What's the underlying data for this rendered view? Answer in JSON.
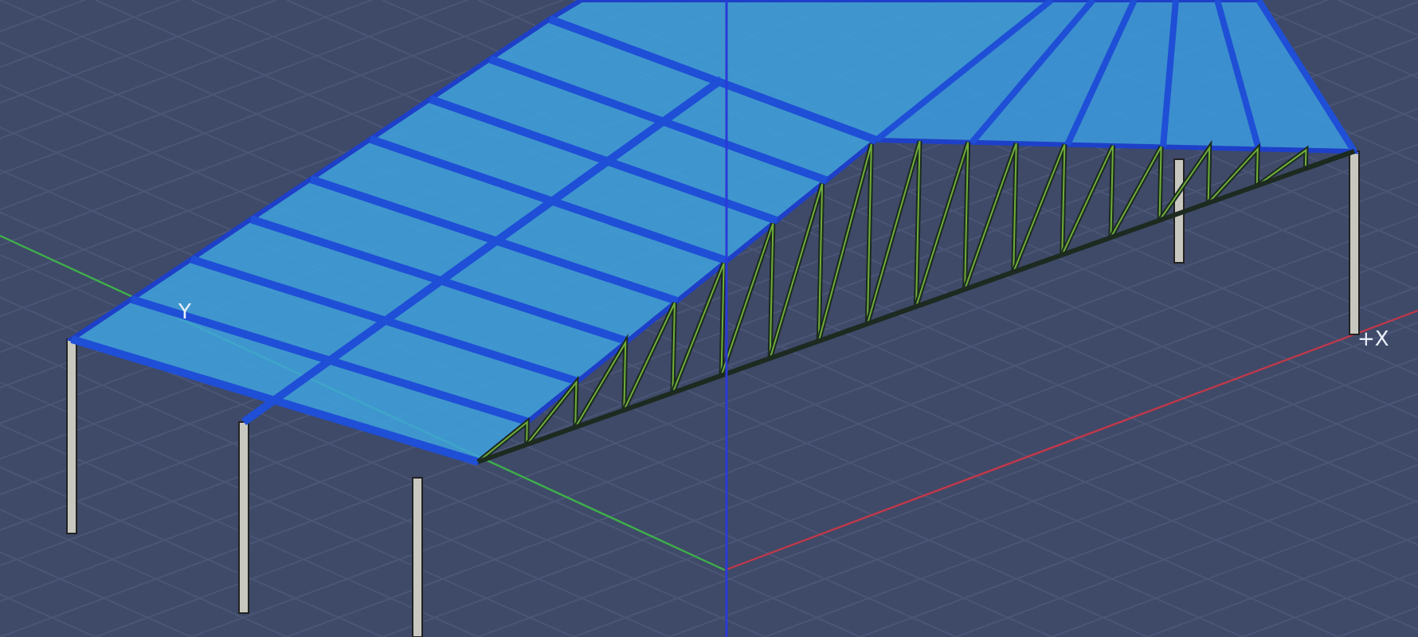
{
  "viewport": {
    "axis_labels": [
      {
        "text": "Y"
      },
      {
        "text": "+X"
      }
    ]
  }
}
